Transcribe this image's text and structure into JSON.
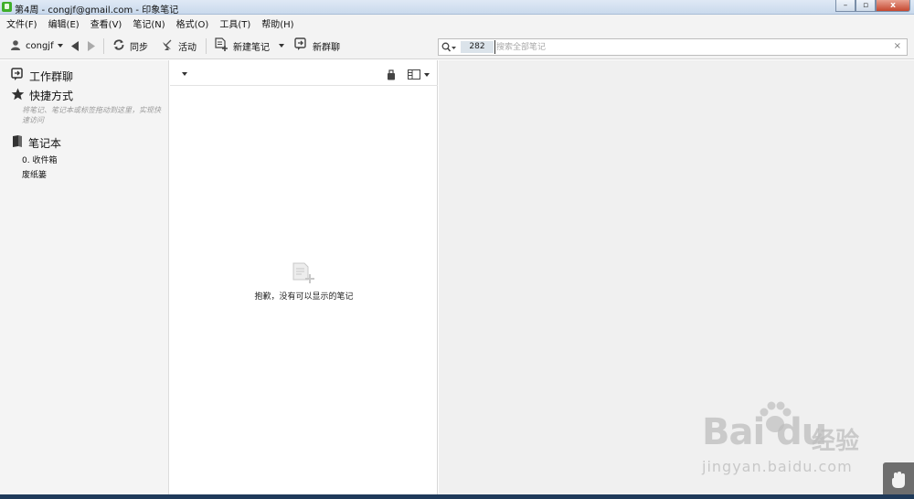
{
  "window": {
    "title": "第4周 - congjf@gmail.com - 印象笔记",
    "minimize": "–",
    "maximize": "▫",
    "close": "x"
  },
  "menu": [
    "文件(F)",
    "编辑(E)",
    "查看(V)",
    "笔记(N)",
    "格式(O)",
    "工具(T)",
    "帮助(H)"
  ],
  "toolbar": {
    "user": "congjf",
    "sync": "同步",
    "activity": "活动",
    "new_note": "新建笔记",
    "new_chat": "新群聊"
  },
  "search": {
    "count": "282",
    "placeholder": "搜索全部笔记",
    "clear": "×"
  },
  "sidebar": {
    "work_chat": "工作群聊",
    "shortcuts": "快捷方式",
    "shortcuts_hint": "将笔记、笔记本或标签拖动到这里，实现快速访问",
    "notebooks": "笔记本",
    "items": [
      "0. 收件箱",
      "废纸篓"
    ]
  },
  "notelist": {
    "empty_message": "抱歉，没有可以显示的笔记"
  },
  "watermark": {
    "logo": "Bai du",
    "cn": "经验",
    "url": "jingyan.baidu.com"
  },
  "colors": {
    "app_green": "#3fae2a",
    "editor_bg": "#f0f0f0",
    "sidebar_bg": "#f4f4f4"
  }
}
